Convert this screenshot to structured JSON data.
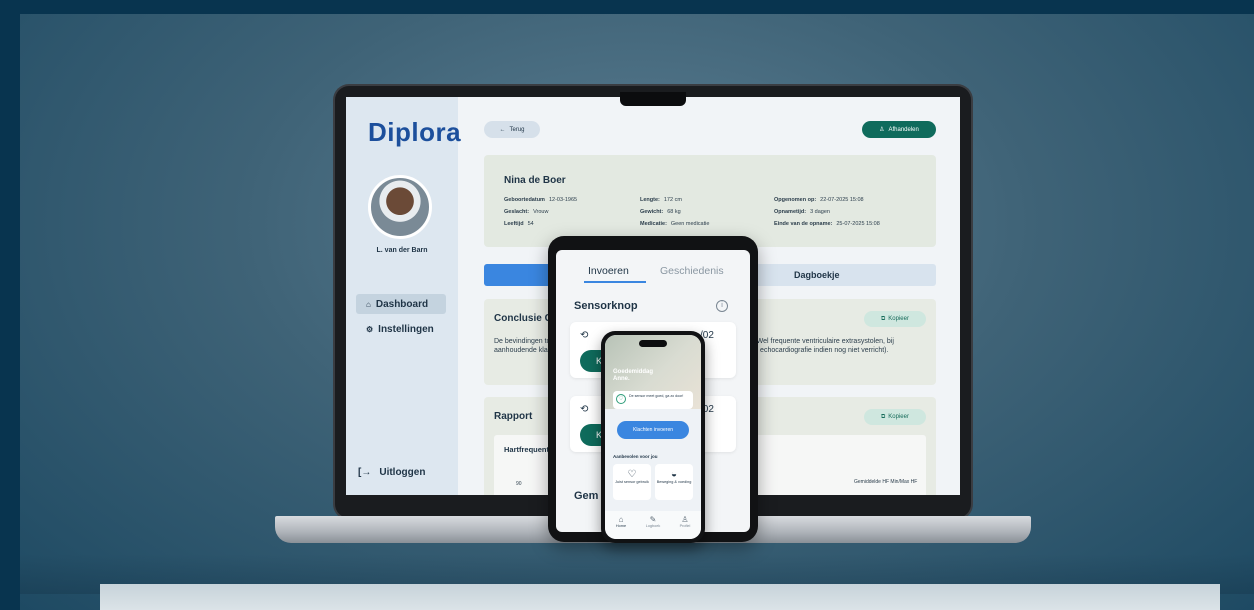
{
  "brand": {
    "logo": "Diplora",
    "accent": "#3a86e0",
    "teal": "#0f6b5c"
  },
  "sidebar": {
    "doctor_name": "L. van der Barn",
    "items": [
      {
        "label": "Dashboard",
        "icon": "home-icon",
        "active": true
      },
      {
        "label": "Instellingen",
        "icon": "gear-icon",
        "active": false
      }
    ],
    "logout": "Uitloggen"
  },
  "header": {
    "back": "Terug",
    "finish": "Afhandelen"
  },
  "patient": {
    "name": "Nina de Boer",
    "fields": [
      {
        "k": "Geboortedatum",
        "v": "12-03-1965"
      },
      {
        "k": "Geslacht:",
        "v": "Vrouw"
      },
      {
        "k": "Leeftijd",
        "v": "54"
      },
      {
        "k": "Lengte:",
        "v": "172 cm"
      },
      {
        "k": "Gewicht:",
        "v": "68 kg"
      },
      {
        "k": "Medicatie:",
        "v": "Geen medicatie"
      },
      {
        "k": "Opgenomen op:",
        "v": "22-07-2025   15:08"
      },
      {
        "k": "Opnametijd:",
        "v": "3 dagen"
      },
      {
        "k": "Einde van de opname:",
        "v": "25-07-2025   15:08"
      }
    ]
  },
  "tabs": {
    "dagboekje": "Dagboekje"
  },
  "conclusie": {
    "title": "Conclusie Cardioloog",
    "copy": "Kopieer",
    "text": "De bevindingen tonen geen klinische relevantie of behandelbehoefte op dit moment. Wel frequente ventriculaire extrasystolen, bij aanhoudende klachten of cardiale voorgeschiedenis geven tot verdere evaluatie (bijv. echocardiografie indien nog niet verricht)."
  },
  "rapport": {
    "title": "Rapport",
    "copy": "Kopieer",
    "chart_title": "Hartfrequentie (BpM)",
    "tick": "90",
    "legend": "Gemiddelde HF Min/Max HF",
    "range": "22 t/m 25 juli 2025"
  },
  "tablet": {
    "tab_active": "Invoeren",
    "tab_inactive": "Geschiedenis",
    "section": "Sensorknop",
    "rows": [
      {
        "date": "/02",
        "pill": "Kl"
      },
      {
        "date": "/02",
        "pill": "Kl"
      }
    ],
    "section2": "Gem"
  },
  "phone": {
    "greeting": "Goedemiddag Anne.",
    "sensor": "De sensor meet goed, ga zo door!",
    "cta": "Klachten invoeren",
    "recommend": "Aanbevolen voor jou",
    "tiles": [
      {
        "label": "Juist sensor gebruik",
        "icon": "heart-monitor-icon"
      },
      {
        "label": "Beweging & voeding",
        "icon": "food-bowl-icon"
      }
    ],
    "nav": [
      {
        "label": "Home",
        "icon": "home-icon"
      },
      {
        "label": "Logboek",
        "icon": "pencil-icon"
      },
      {
        "label": "Profiel",
        "icon": "user-icon"
      }
    ]
  }
}
